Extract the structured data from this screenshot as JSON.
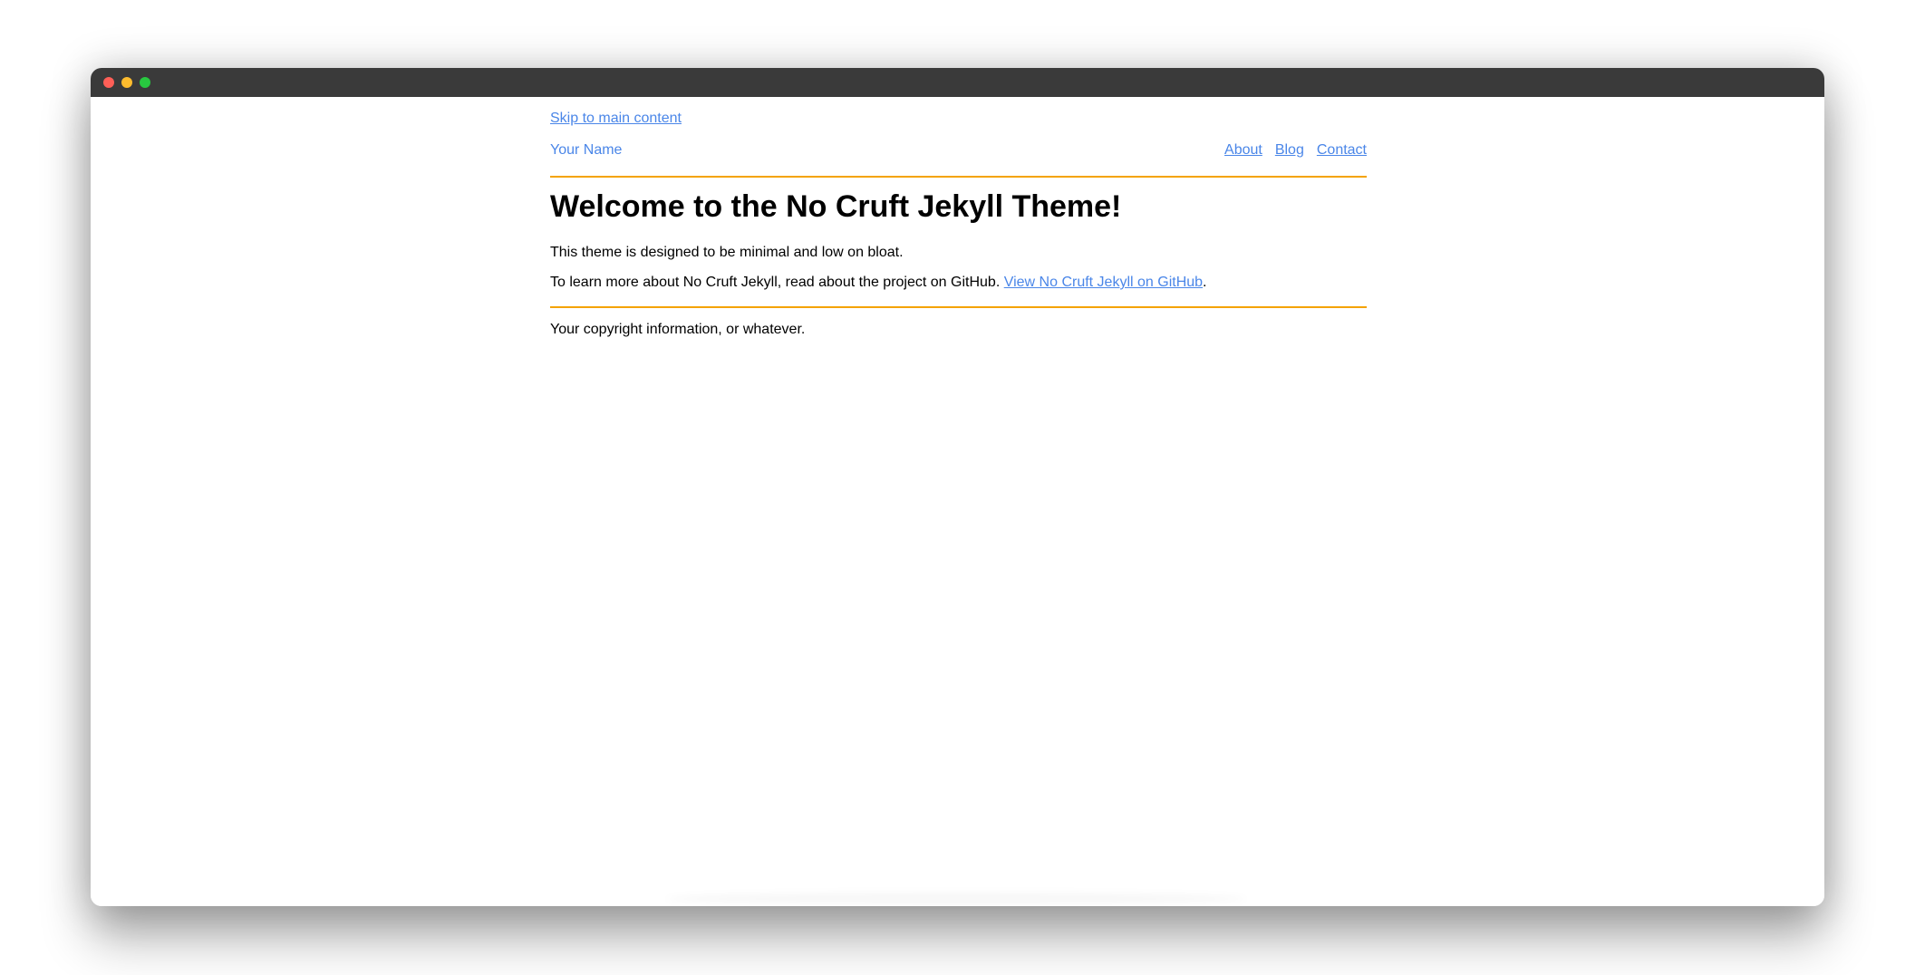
{
  "window": {
    "colors": {
      "titlebar": "#3a3a3a",
      "close": "#ff5f57",
      "minimize": "#febc2e",
      "zoom": "#28c840"
    }
  },
  "page": {
    "skip_link": "Skip to main content",
    "site_name": "Your Name",
    "nav": [
      "About",
      "Blog",
      "Contact"
    ],
    "heading": "Welcome to the No Cruft Jekyll Theme!",
    "paragraph1": "This theme is designed to be minimal and low on bloat.",
    "paragraph2_text": "To learn more about No Cruft Jekyll, read about the project on GitHub. ",
    "paragraph2_link": "View No Cruft Jekyll on GitHub",
    "paragraph2_end": ".",
    "footer": "Your copyright information, or whatever.",
    "colors": {
      "link": "#4a86e8",
      "rule": "#f4a300",
      "text": "#000000"
    }
  }
}
